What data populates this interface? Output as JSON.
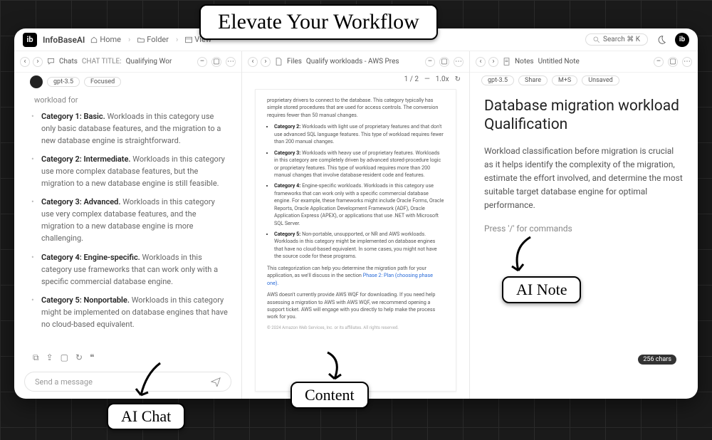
{
  "brand": "InfoBaseAI",
  "breadcrumbs": {
    "home": "Home",
    "folder": "Folder",
    "view": "View"
  },
  "search": {
    "placeholder": "Search ⌘ K"
  },
  "annotations": {
    "hero": "Elevate Your Workflow",
    "chat": "AI Chat",
    "content": "Content",
    "note": "AI Note"
  },
  "chat": {
    "tab_label": "Chats",
    "title_prefix": "CHAT TITLE:",
    "title": "Qualifying Wor",
    "model": "gpt-3.5",
    "mode": "Focused",
    "lead": "workload for",
    "items": [
      {
        "name": "Category 1: Basic.",
        "text": "Workloads in this category use only basic database features, and the migration to a new database engine is straightforward."
      },
      {
        "name": "Category 2: Intermediate.",
        "text": "Workloads in this category use more complex database features, but the migration to a new database engine is still feasible."
      },
      {
        "name": "Category 3: Advanced.",
        "text": "Workloads in this category use very complex database features, and the migration to a new database engine is more challenging."
      },
      {
        "name": "Category 4: Engine-specific.",
        "text": "Workloads in this category use frameworks that can work only with a specific commercial database engine."
      },
      {
        "name": "Category 5: Nonportable.",
        "text": "Workloads in this category might be implemented on database engines that have no cloud-based equivalent."
      }
    ],
    "input_placeholder": "Send a message"
  },
  "file": {
    "tab_label": "Files",
    "name": "Qualify workloads - AWS Pres",
    "pager": "1 / 2",
    "zoom_sep": "—",
    "zoom": "1.0x",
    "intro": "proprietary drivers to connect to the database. This category typically has simple stored procedures that are used for access controls. The conversion requires fewer than 50 manual changes.",
    "items": [
      {
        "name": "Category 2:",
        "text": "Workloads with light use of proprietary features and that don't use advanced SQL language features. This type of workload requires fewer than 200 manual changes."
      },
      {
        "name": "Category 3:",
        "text": "Workloads with heavy use of proprietary features. Workloads in this category are completely driven by advanced stored-procedure logic or proprietary features. This type of workload requires more than 200 manual changes that involve database-resident code and features."
      },
      {
        "name": "Category 4:",
        "text": "Engine-specific workloads. Workloads in this category use frameworks that can work only with a specific commercial database engine. For example, these frameworks might include Oracle Forms, Oracle Reports, Oracle Application Development Framework (ADF), Oracle Application Express (APEX), or applications that use .NET with Microsoft SQL Server."
      },
      {
        "name": "Category 5:",
        "text": "Non-portable, unsupported, or NR and AWS workloads. Workloads in this category might be implemented on database engines that have no cloud-based equivalent. In some cases, you might not have the source code for these programs."
      }
    ],
    "para1": "This categorization can help you determine the migration path for your application, as we'll discuss in the section",
    "link": "Phase 2: Plan (choosing phase one).",
    "para2": "AWS doesn't currently provide AWS WQF for downloading. If you need help assessing a migration to AWS with AWS WQF, we recommend opening a support ticket. AWS will engage with you directly to help make the process work for you.",
    "footer": "© 2024 Amazon Web Services, Inc. or its affiliates. All rights reserved."
  },
  "note": {
    "tab_label": "Notes",
    "name": "Untitled Note",
    "model": "gpt-3.5",
    "share": "Share",
    "ms": "M+S",
    "unsaved": "Unsaved",
    "title": "Database migration workload Qualification",
    "para": "Workload classification before migration is crucial as it helps identify the complexity of the migration, estimate the effort involved, and determine the most suitable target database engine for optimal performance.",
    "hint": "Press '/' for commands"
  },
  "char_count": "256 chars"
}
